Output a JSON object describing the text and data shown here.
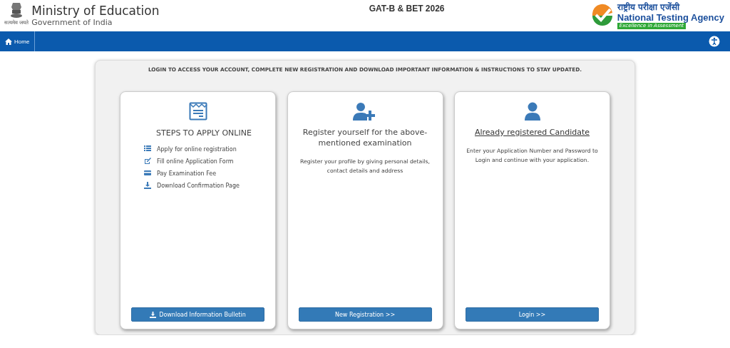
{
  "header": {
    "emblem_motto": "सत्यमेव जयते",
    "ministry": "Ministry of Education",
    "government": "Government of India",
    "exam_title": "GAT-B & BET 2026",
    "agency_hindi": "राष्ट्रीय परीक्षा एजेंसी",
    "agency": "National Testing Agency",
    "agency_tagline": "Excellence in Assessment"
  },
  "nav": {
    "items": [
      {
        "label": "Home"
      }
    ]
  },
  "notice": "LOGIN TO ACCESS YOUR ACCOUNT, COMPLETE NEW REGISTRATION AND DOWNLOAD IMPORTANT INFORMATION & INSTRUCTIONS TO STAY UPDATED.",
  "cards": [
    {
      "kind": "steps",
      "title": "STEPS TO APPLY ONLINE",
      "steps": [
        "Apply for online registration",
        "Fill online Application Form",
        "Pay Examination Fee",
        "Download Confirmation Page"
      ],
      "button": "Download Information Bulletin"
    },
    {
      "kind": "register",
      "title": "Register yourself for the above-mentioned examination",
      "text": "Register your profile by giving personal details, contact details and address",
      "button": "New Registration >>"
    },
    {
      "kind": "login",
      "title": "Already registered Candidate",
      "text": "Enter your Application Number and Password to Login and continue with your application.",
      "button": "Login >>"
    }
  ]
}
